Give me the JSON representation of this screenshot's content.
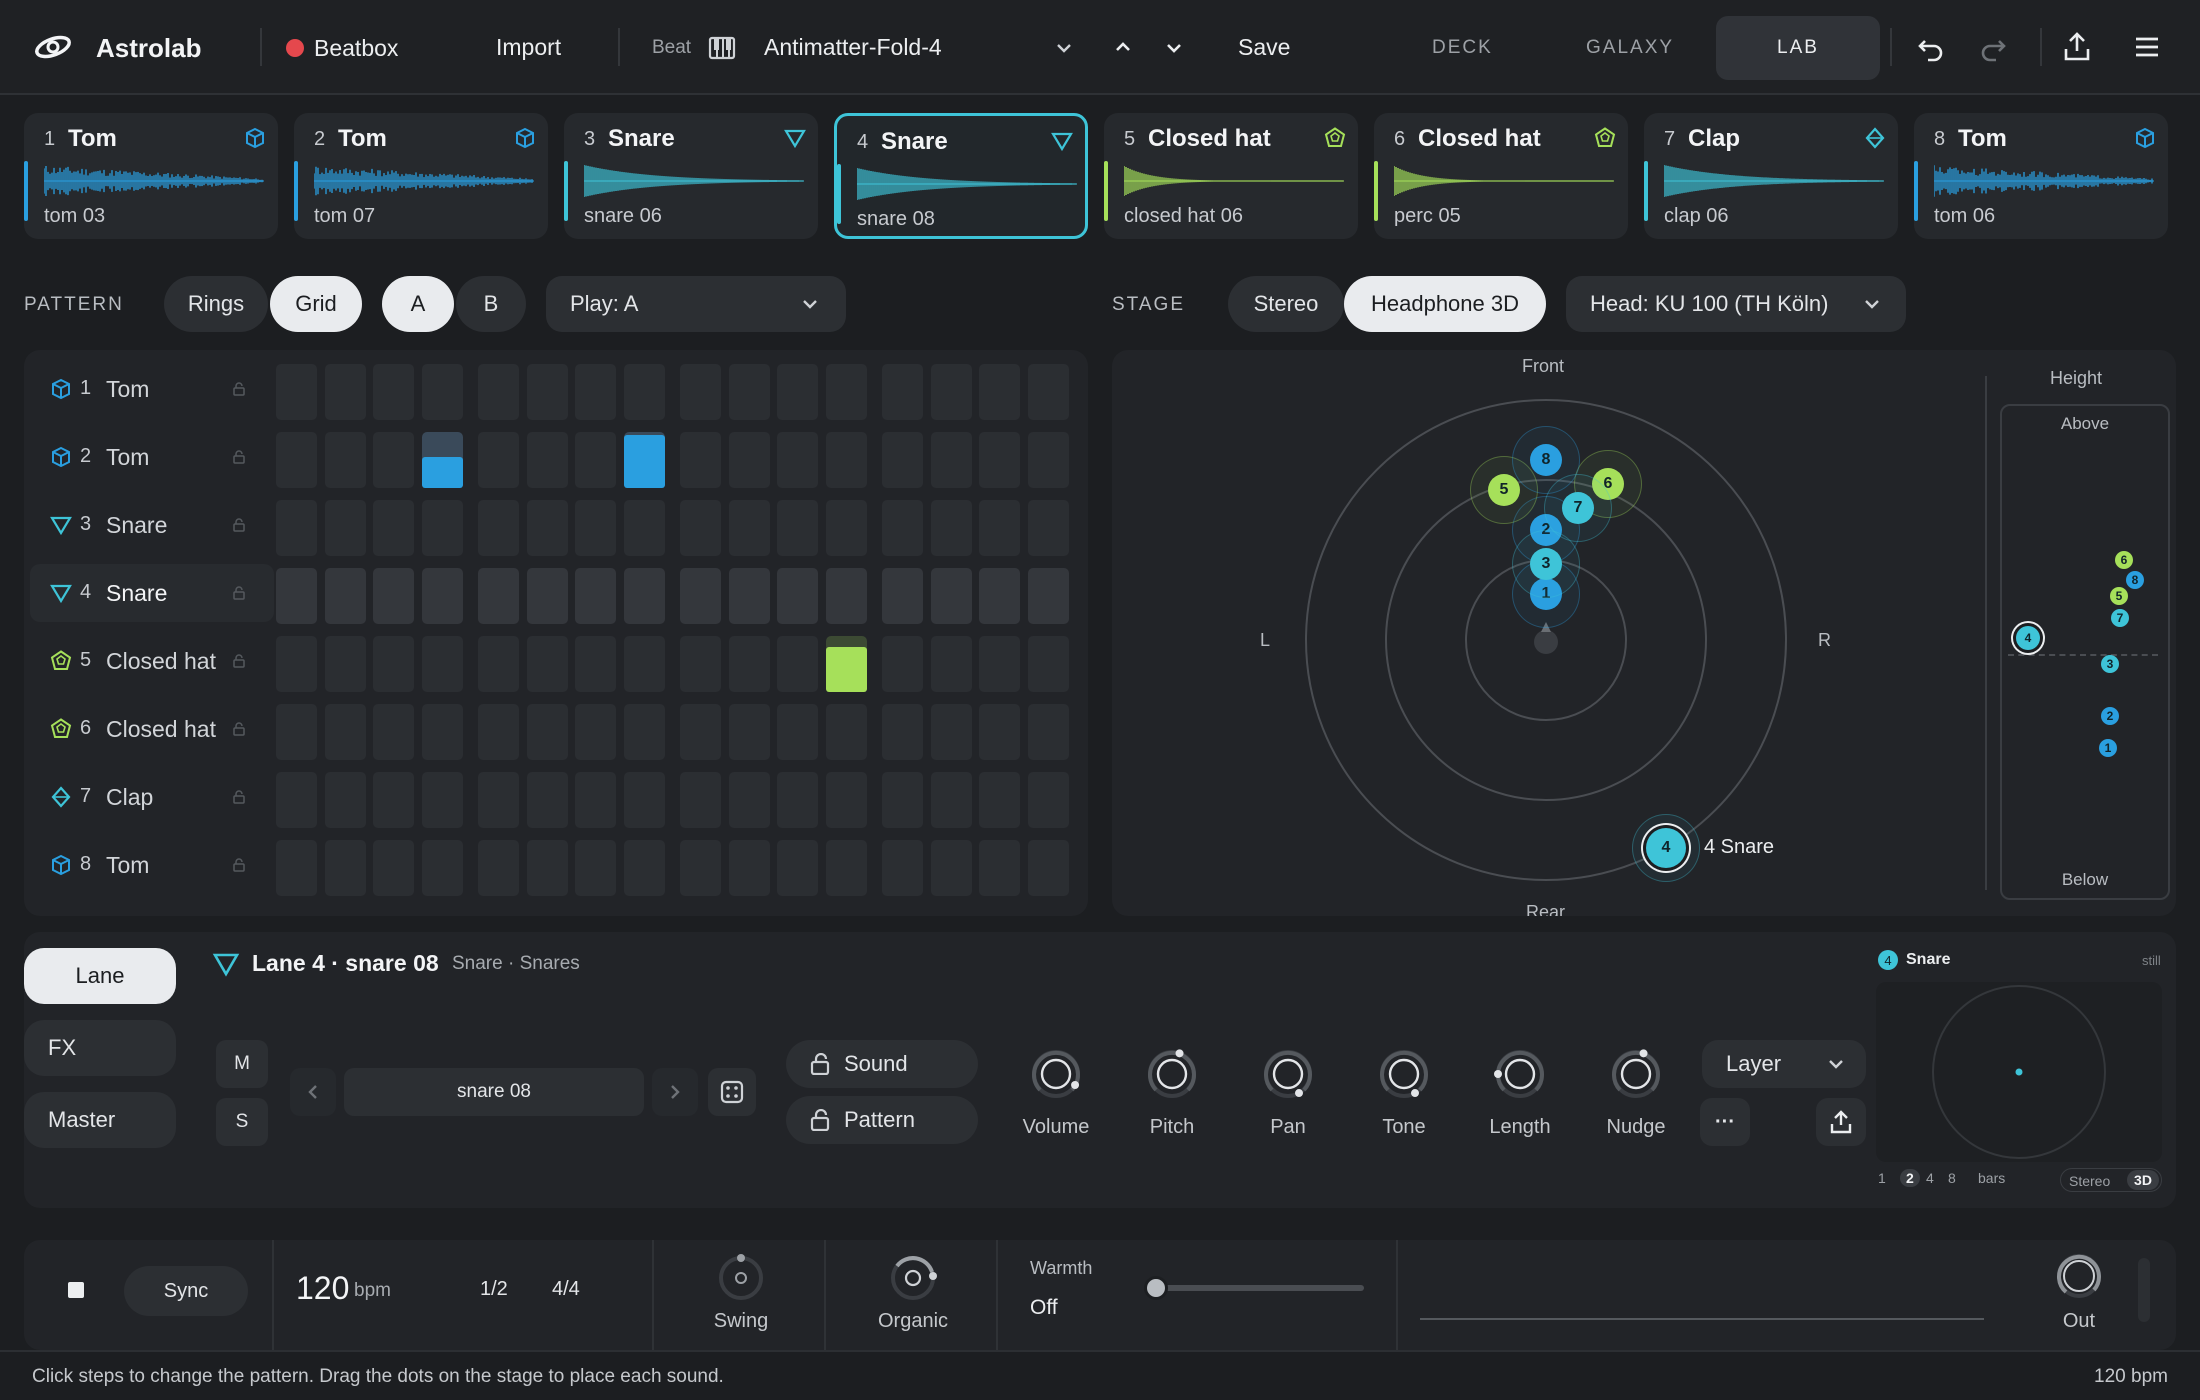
{
  "app": {
    "name": "Astrolab"
  },
  "topbar": {
    "record_label": "Beatbox",
    "import_label": "Import",
    "beat_label": "Beat",
    "beat_name": "Antimatter-Fold-4",
    "save_label": "Save",
    "modes": [
      "DECK",
      "GALAXY",
      "LAB"
    ],
    "active_mode": "LAB"
  },
  "lanes": [
    {
      "num": "1",
      "name": "Tom",
      "sample": "tom 03",
      "icon": "cube-icon",
      "color": "#2a9fe0"
    },
    {
      "num": "2",
      "name": "Tom",
      "sample": "tom 07",
      "icon": "cube-icon",
      "color": "#2a9fe0"
    },
    {
      "num": "3",
      "name": "Snare",
      "sample": "snare 06",
      "icon": "triangle-icon",
      "color": "#3ec4d8"
    },
    {
      "num": "4",
      "name": "Snare",
      "sample": "snare 08",
      "icon": "triangle-icon",
      "color": "#3ec4d8"
    },
    {
      "num": "5",
      "name": "Closed hat",
      "sample": "closed hat 06",
      "icon": "dodecahedron-icon",
      "color": "#a6e05a"
    },
    {
      "num": "6",
      "name": "Closed hat",
      "sample": "perc 05",
      "icon": "dodecahedron-icon",
      "color": "#a6e05a"
    },
    {
      "num": "7",
      "name": "Clap",
      "sample": "clap 06",
      "icon": "diamond-icon",
      "color": "#3ec4d8"
    },
    {
      "num": "8",
      "name": "Tom",
      "sample": "tom 06",
      "icon": "cube-icon",
      "color": "#2a9fe0"
    }
  ],
  "selected_lane": "4",
  "pattern": {
    "label": "PATTERN",
    "views": [
      "Rings",
      "Grid"
    ],
    "active_view": "Grid",
    "variants": [
      "A",
      "B"
    ],
    "active_variant": "A",
    "play_label": "Play: A",
    "steps": 16,
    "active_steps": [
      {
        "lane": 2,
        "step": 3,
        "level": 0.55
      },
      {
        "lane": 2,
        "step": 7,
        "level": 0.95
      },
      {
        "lane": 5,
        "step": 11,
        "level": 0.8
      }
    ]
  },
  "stage": {
    "label": "STAGE",
    "modes": [
      "Stereo",
      "Headphone 3D"
    ],
    "active_mode": "Headphone 3D",
    "head_label": "Head: KU 100 (TH Köln)",
    "front": "Front",
    "rear": "Rear",
    "left": "L",
    "right": "R",
    "height_title": "Height",
    "above": "Above",
    "below": "Below",
    "selected_tag": "4 Snare"
  },
  "lane_panel": {
    "tabs": [
      "Lane",
      "FX",
      "Master"
    ],
    "active_tab": "Lane",
    "title": "Lane 4 · snare 08",
    "subtitle": "Snare · Snares",
    "mute": "M",
    "solo": "S",
    "sample": "snare 08",
    "sound_label": "Sound",
    "pattern_label": "Pattern",
    "knobs": [
      "Volume",
      "Pitch",
      "Pan",
      "Tone",
      "Length",
      "Nudge"
    ],
    "layer_label": "Layer",
    "more_label": "···"
  },
  "mini_stage": {
    "lane_num": "4",
    "title": "Snare",
    "state": "still",
    "bars_options": [
      "1",
      "2",
      "4",
      "8"
    ],
    "bars_active": "2",
    "bars_label": "bars",
    "view_options": [
      "Stereo",
      "3D"
    ],
    "view_active": "3D"
  },
  "transport": {
    "sync_label": "Sync",
    "bpm": "120",
    "bpm_unit": "bpm",
    "division": "1/2",
    "meter": "4/4",
    "swing_label": "Swing",
    "organic_label": "Organic",
    "warmth_label": "Warmth",
    "warmth_value": "Off",
    "warmth_level": 0.0,
    "out_label": "Out"
  },
  "status": {
    "hint": "Click steps to change the pattern. Drag the dots on the stage to place each sound.",
    "bpm_readout": "120 bpm"
  },
  "colors": {
    "accent": "#3ec4d8",
    "tom": "#2a9fe0",
    "hat": "#a6e05a",
    "record": "#e5484d"
  }
}
